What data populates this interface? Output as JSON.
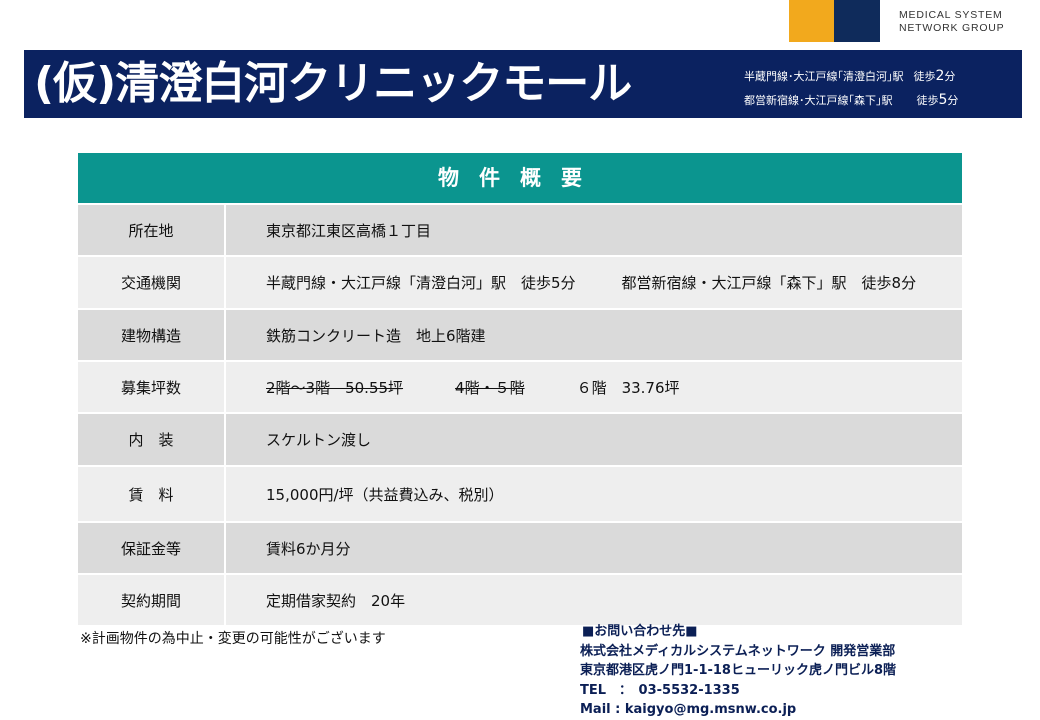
{
  "logo": {
    "line1": "MEDICAL SYSTEM",
    "line2": "NETWORK GROUP"
  },
  "banner": {
    "title": "(仮)清澄白河クリニックモール",
    "access": [
      {
        "line": "半蔵門線･大江戸線｢清澄白河｣駅",
        "walk": "徒歩",
        "min": "2",
        "unit": "分"
      },
      {
        "line": "都営新宿線･大江戸線｢森下｣駅",
        "walk": "徒歩",
        "min": "5",
        "unit": "分"
      }
    ]
  },
  "table": {
    "header": "物件概要",
    "rows": [
      {
        "label": "所在地",
        "value": "東京都江東区高橋１丁目"
      },
      {
        "label": "交通機関",
        "value_a": "半蔵門線・大江戸線「清澄白河」駅　徒歩5分",
        "value_b": "都営新宿線・大江戸線「森下」駅　徒歩8分"
      },
      {
        "label": "建物構造",
        "value": "鉄筋コンクリート造　地上6階建"
      },
      {
        "label": "募集坪数",
        "struck_a": "2階～3階　50.55坪",
        "struck_b": "4階・５階",
        "value": "６階　33.76坪"
      },
      {
        "label": "内　装",
        "value": "スケルトン渡し"
      },
      {
        "label": "賃　料",
        "value": "15,000円/坪（共益費込み、税別）"
      },
      {
        "label": "保証金等",
        "value": "賃料6か月分"
      },
      {
        "label": "契約期間",
        "value": "定期借家契約　20年"
      }
    ]
  },
  "note": "※計画物件の為中止・変更の可能性がございます",
  "contact": {
    "heading": "■お問い合わせ先■",
    "company": "株式会社メディカルシステムネットワーク 開発営業部",
    "address": "東京都港区虎ノ門1-1-18ヒューリック虎ノ門ビル8階",
    "tel": "TEL　：　03-5532-1335",
    "mail": "Mail : kaigyo@mg.msnw.co.jp"
  },
  "colors": {
    "navy": "#0b2260",
    "teal": "#0b958f",
    "gold": "#f2a91d"
  }
}
